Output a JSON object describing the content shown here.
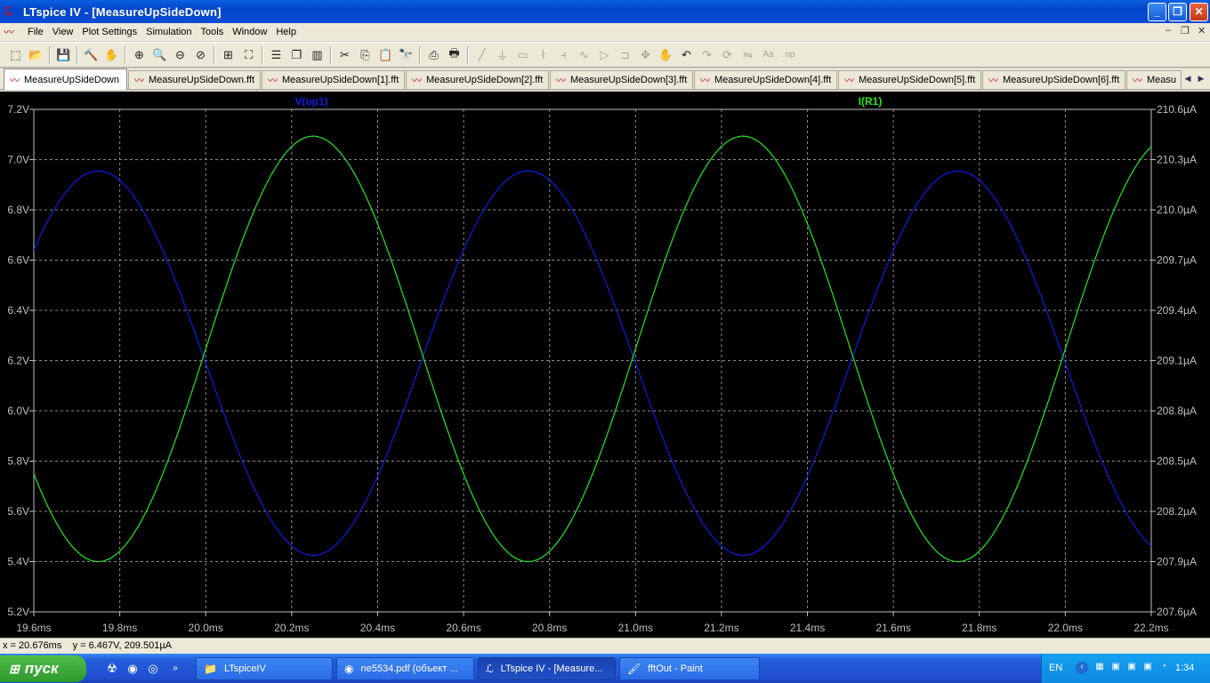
{
  "window": {
    "title": "LTspice IV - [MeasureUpSideDown]"
  },
  "menu": [
    "File",
    "View",
    "Plot Settings",
    "Simulation",
    "Tools",
    "Window",
    "Help"
  ],
  "toolbar_icons": [
    "new-schematic",
    "open-folder",
    "sep",
    "save",
    "sep",
    "control-panel",
    "pan-hand",
    "sep",
    "zoom-in",
    "zoom-area",
    "zoom-out",
    "zoom-cancel",
    "sep",
    "autorange",
    "zoom-full",
    "sep",
    "tile-horizontal",
    "cascade",
    "tile-vertical",
    "sep",
    "cut",
    "copy",
    "paste",
    "find",
    "sep",
    "print-preview",
    "print",
    "sep",
    "wire",
    "ground",
    "label",
    "resistor",
    "capacitor",
    "inductor",
    "diode",
    "component",
    "move",
    "drag",
    "undo",
    "redo",
    "rotate",
    "mirror",
    "text",
    "spice-directive"
  ],
  "tabs": [
    {
      "label": "MeasureUpSideDown",
      "active": true
    },
    {
      "label": "MeasureUpSideDown.fft"
    },
    {
      "label": "MeasureUpSideDown[1].fft"
    },
    {
      "label": "MeasureUpSideDown[2].fft"
    },
    {
      "label": "MeasureUpSideDown[3].fft"
    },
    {
      "label": "MeasureUpSideDown[4].fft"
    },
    {
      "label": "MeasureUpSideDown[5].fft"
    },
    {
      "label": "MeasureUpSideDown[6].fft"
    },
    {
      "label": "Measu"
    }
  ],
  "status": {
    "text": "x = 20.676ms    y = 6.467V, 209.501µA"
  },
  "taskbar": {
    "start_label": "пуск",
    "tasks": [
      {
        "label": "LTspiceIV",
        "icon": "folder-icon"
      },
      {
        "label": "ne5534.pdf (объект ...",
        "icon": "firefox-icon"
      },
      {
        "label": "LTspice IV - [Measure...",
        "icon": "ltspice-icon",
        "active": true
      },
      {
        "label": "fftOut - Paint",
        "icon": "paint-icon"
      }
    ],
    "lang": "EN",
    "clock": "1:34"
  },
  "chart_data": {
    "type": "line",
    "x": {
      "min": 19.6,
      "max": 22.2,
      "unit": "ms",
      "ticks": [
        "19.6ms",
        "19.8ms",
        "20.0ms",
        "20.2ms",
        "20.4ms",
        "20.6ms",
        "20.8ms",
        "21.0ms",
        "21.2ms",
        "21.4ms",
        "21.6ms",
        "21.8ms",
        "22.0ms",
        "22.2ms"
      ]
    },
    "y_left": {
      "min": 5.2,
      "max": 7.2,
      "unit": "V",
      "ticks": [
        "5.2V",
        "5.4V",
        "5.6V",
        "5.8V",
        "6.0V",
        "6.2V",
        "6.4V",
        "6.6V",
        "6.8V",
        "7.0V",
        "7.2V"
      ]
    },
    "y_right": {
      "min": 207.6,
      "max": 210.6,
      "unit": "µA",
      "ticks": [
        "207.6µA",
        "207.9µA",
        "208.2µA",
        "208.5µA",
        "208.8µA",
        "209.1µA",
        "209.4µA",
        "209.7µA",
        "210.0µA",
        "210.3µA",
        "210.6µA"
      ]
    },
    "grid": true,
    "series": [
      {
        "name": "V(op1)",
        "axis": "left",
        "color": "#0a1ee6",
        "shape": "sine",
        "offset": 6.19,
        "amplitude": 0.765,
        "period_ms": 1.0,
        "peak_at_ms": 19.75
      },
      {
        "name": "I(R1)",
        "axis": "right",
        "color": "#22e622",
        "shape": "sine",
        "offset": 209.17,
        "amplitude": 1.27,
        "period_ms": 1.0,
        "peak_at_ms": 20.25
      }
    ]
  }
}
